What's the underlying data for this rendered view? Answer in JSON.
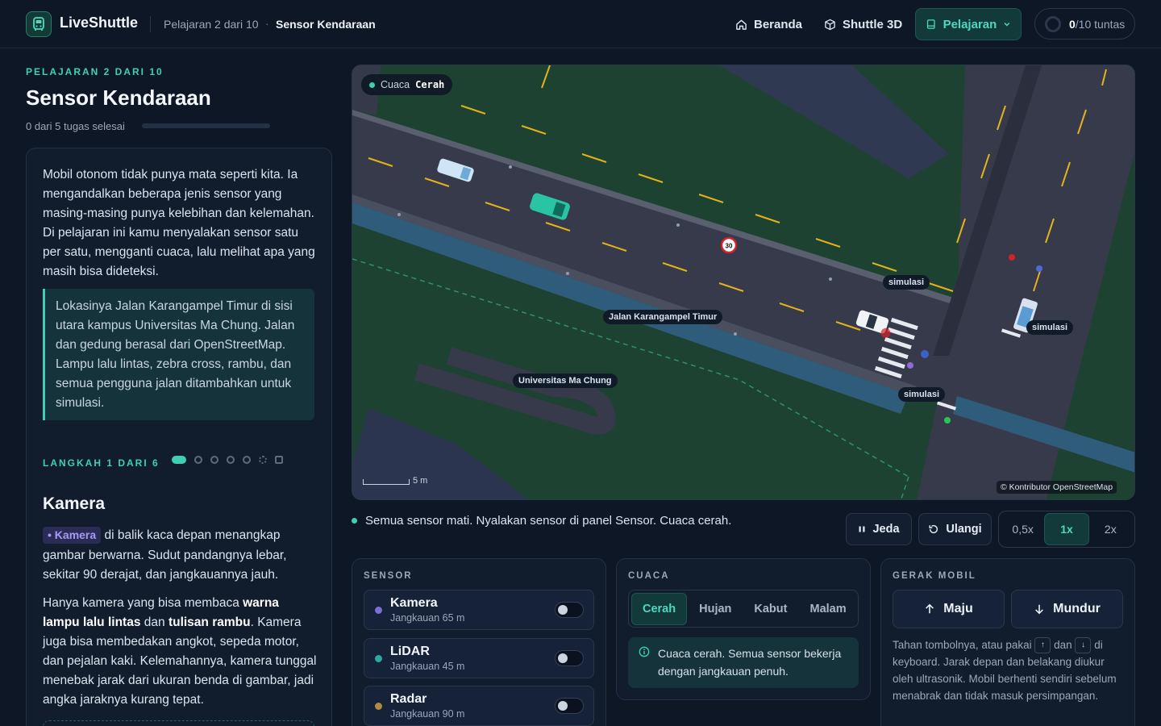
{
  "header": {
    "brand": "LiveShuttle",
    "crumb_lesson": "Pelajaran 2 dari 10",
    "crumb_sep": "·",
    "crumb_current": "Sensor Kendaraan",
    "nav_home": "Beranda",
    "nav_3d": "Shuttle 3D",
    "nav_lesson": "Pelajaran",
    "progress_done": "0",
    "progress_rest": "/10 tuntas"
  },
  "lesson": {
    "eyebrow": "PELAJARAN 2 DARI 10",
    "title": "Sensor Kendaraan",
    "task_count": "0 dari 5 tugas selesai",
    "task_progress": 0,
    "intro": "Mobil otonom tidak punya mata seperti kita. Ia mengandalkan beberapa jenis sensor yang masing-masing punya kelebihan dan kelemahan. Di pelajaran ini kamu menyalakan sensor satu per satu, mengganti cuaca, lalu melihat apa yang masih bisa dideteksi.",
    "callout": "Lokasinya Jalan Karangampel Timur di sisi utara kampus Universitas Ma Chung. Jalan dan gedung berasal dari OpenStreetMap. Lampu lalu lintas, zebra cross, rambu, dan semua pengguna jalan ditambahkan untuk simulasi.",
    "step_label": "LANGKAH 1 DARI 6",
    "step_title": "Kamera",
    "step_chip": "• Kamera",
    "step_p1_rest": " di balik kaca depan menangkap gambar berwarna. Sudut pandangnya lebar, sekitar 90 derajat, dan jangkauannya jauh.",
    "step_p2_a": "Hanya kamera yang bisa membaca ",
    "step_p2_b": "warna lampu lalu lintas",
    "step_p2_c": " dan ",
    "step_p2_d": "tulisan rambu",
    "step_p2_e": ". Kamera juga bisa membedakan angkot, sepeda motor, dan pejalan kaki. Kelemahannya, kamera tunggal menebak jarak dari ukuran benda di gambar, jadi angka jaraknya kurang tepat."
  },
  "map": {
    "weather_prefix": "Cuaca",
    "weather_value": "Cerah",
    "label_road": "Jalan Karangampel Timur",
    "label_campus": "Universitas Ma Chung",
    "label_sim": "simulasi",
    "speed_sign": "30",
    "scale": "5 m",
    "attribution": "© Kontributor OpenStreetMap"
  },
  "status": "Semua sensor mati. Nyalakan sensor di panel Sensor. Cuaca cerah.",
  "controls": {
    "pause": "Jeda",
    "reset": "Ulangi",
    "speeds": [
      "0,5x",
      "1x",
      "2x"
    ],
    "speed_selected": "1x"
  },
  "sensor_panel": {
    "title": "SENSOR",
    "items": [
      {
        "name": "Kamera",
        "range": "Jangkauan 65 m",
        "color": "#7b6fd6",
        "on": false
      },
      {
        "name": "LiDAR",
        "range": "Jangkauan 45 m",
        "color": "#2aa9a0",
        "on": false
      },
      {
        "name": "Radar",
        "range": "Jangkauan 90 m",
        "color": "#b08a3e",
        "on": false
      }
    ]
  },
  "weather_panel": {
    "title": "CUACA",
    "options": [
      "Cerah",
      "Hujan",
      "Kabut",
      "Malam"
    ],
    "selected": "Cerah",
    "info": "Cuaca cerah. Semua sensor bekerja dengan jangkauan penuh."
  },
  "move_panel": {
    "title": "GERAK MOBIL",
    "forward": "Maju",
    "backward": "Mundur",
    "help_a": "Tahan tombolnya, atau pakai",
    "help_b": "dan",
    "help_c": "di keyboard. Jarak depan dan belakang diukur oleh ultrasonik. Mobil berhenti sendiri sebelum menabrak dan tidak masuk persimpangan.",
    "key_up": "↑",
    "key_down": "↓"
  },
  "colors": {
    "accent": "#3fd0b4",
    "background": "#0e1726",
    "panel": "#111c2d",
    "grass": "#1e4231",
    "road": "#373a4a",
    "lane_marking": "#e3b21a"
  }
}
